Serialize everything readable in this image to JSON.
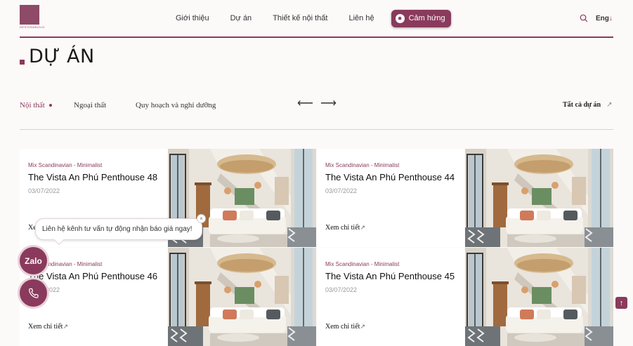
{
  "brand": {
    "logo_text": "DESIGN&BUILD",
    "accent": "#8a3a5c"
  },
  "nav": {
    "items": [
      "Giới thiệu",
      "Dự án",
      "Thiết kế nội thất",
      "Liên hệ"
    ],
    "inspire_label": "Cảm hứng",
    "lang_label": "Eng",
    "lang_arrow": "↓"
  },
  "page": {
    "title": "DỰ ÁN"
  },
  "tabs": {
    "items": [
      "Nội thất",
      "Ngoại thất",
      "Quy hoạch và nghỉ dưỡng"
    ],
    "prev_arrow": "⟵",
    "next_arrow": "⟶",
    "all_label": "Tất cả dự án",
    "all_arrow": "↗"
  },
  "projects": [
    {
      "category": "Mix Scandinavian - Minimalist",
      "name": "The Vista An Phú Penthouse 48",
      "date": "03/07/2022",
      "more": "Xem chi tiết",
      "more_arrow": "↗"
    },
    {
      "category": "Mix Scandinavian - Minimalist",
      "name": "The Vista An Phú Penthouse 44",
      "date": "03/07/2022",
      "more": "Xem chi tiết",
      "more_arrow": "↗"
    },
    {
      "category": "Mix Scandinavian - Minimalist",
      "name": "The Vista An Phú Penthouse 46",
      "date": "03/07/2022",
      "more": "Xem chi tiết",
      "more_arrow": "↗"
    },
    {
      "category": "Mix Scandinavian - Minimalist",
      "name": "The Vista An Phú Penthouse 45",
      "date": "03/07/2022",
      "more": "Xem chi tiết",
      "more_arrow": "↗"
    }
  ],
  "chat": {
    "message": "Liên hệ kênh tư vấn tự động nhận báo giá ngay!",
    "close": "×",
    "zalo_label": "Zalo"
  },
  "scroll_top": "↑"
}
